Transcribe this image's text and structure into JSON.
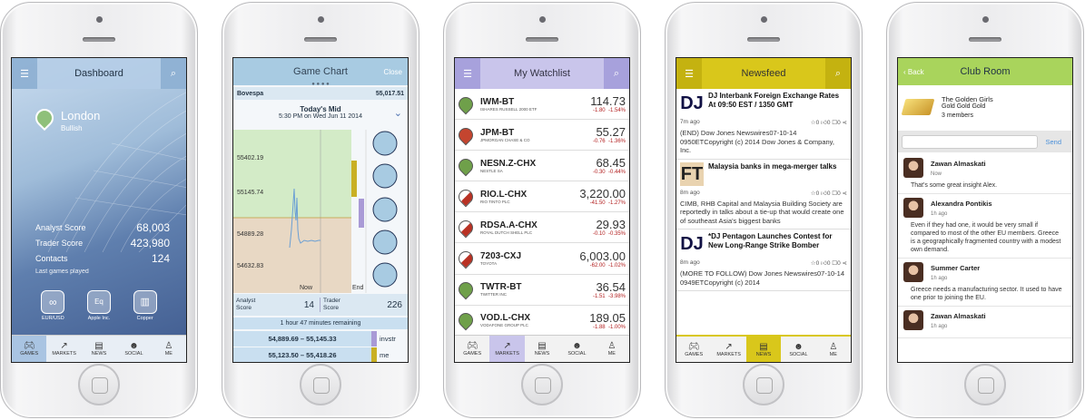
{
  "screen1": {
    "title": "Dashboard",
    "city": "London",
    "mood": "Bullish",
    "stats": [
      {
        "label": "Analyst Score",
        "value": "68,003"
      },
      {
        "label": "Trader Score",
        "value": "423,980"
      },
      {
        "label": "Contacts",
        "value": "124"
      }
    ],
    "last_label": "Last games played",
    "games": [
      {
        "label": "EUR/USD",
        "icon": "coins-icon"
      },
      {
        "label": "Apple Inc.",
        "icon": "eq-icon"
      },
      {
        "label": "Copper",
        "icon": "commodity-icon"
      }
    ]
  },
  "tabs": [
    "GAMES",
    "MARKETS",
    "NEWS",
    "SOCIAL",
    "ME"
  ],
  "screen2": {
    "title": "Game Chart",
    "close": "Close",
    "index_name": "Bovespa",
    "index_value": "55,017.51",
    "mid_title": "Today's Mid",
    "mid_time": "5:30 PM on Wed Jun 11 2014",
    "y_ticks": [
      "55402.19",
      "55145.74",
      "54889.28",
      "54632.83"
    ],
    "x_now": "Now",
    "x_end": "End",
    "analyst_label": "Analyst Score",
    "analyst_value": "14",
    "trader_label": "Trader Score",
    "trader_value": "226",
    "remaining": "1 hour 47 minutes remaining",
    "ranges": [
      {
        "range": "54,889.69 – 55,145.33",
        "tag": "invstr"
      },
      {
        "range": "55,123.50 – 55,418.26",
        "tag": "me"
      }
    ]
  },
  "screen3": {
    "title": "My Watchlist",
    "rows": [
      {
        "sym": "IWM-BT",
        "name": "ISHARES RUSSELL 2000 ETF",
        "price": "114.73",
        "chg": "-1.80",
        "pct": "-1.54%",
        "color": "green"
      },
      {
        "sym": "JPM-BT",
        "name": "JPMORGAN CHASE & CO",
        "price": "55.27",
        "chg": "-0.76",
        "pct": "-1.36%",
        "color": "red"
      },
      {
        "sym": "NESN.Z-CHX",
        "name": "NESTLE SA",
        "price": "68.45",
        "chg": "-0.30",
        "pct": "-0.44%",
        "color": "green"
      },
      {
        "sym": "RIO.L-CHX",
        "name": "RIO TINTO PLC",
        "price": "3,220.00",
        "chg": "-41.50",
        "pct": "-1.27%",
        "color": "half"
      },
      {
        "sym": "RDSA.A-CHX",
        "name": "ROYAL DUTCH SHELL PLC",
        "price": "29.93",
        "chg": "-0.10",
        "pct": "-0.35%",
        "color": "half"
      },
      {
        "sym": "7203-CXJ",
        "name": "TOYOTA",
        "price": "6,003.00",
        "chg": "-62.00",
        "pct": "-1.02%",
        "color": "half"
      },
      {
        "sym": "TWTR-BT",
        "name": "TWITTER INC",
        "price": "36.54",
        "chg": "-1.51",
        "pct": "-3.98%",
        "color": "green"
      },
      {
        "sym": "VOD.L-CHX",
        "name": "VODAFONE GROUP PLC",
        "price": "189.05",
        "chg": "-1.88",
        "pct": "-1.00%",
        "color": "green"
      }
    ]
  },
  "screen4": {
    "title": "Newsfeed",
    "items": [
      {
        "logo": "DJ",
        "head": "DJ Interbank Foreign Exchange Rates At 09:50 EST / 1350 GMT",
        "time": "7m ago",
        "body": "(END) Dow Jones Newswires07-10-14 0950ETCopyright (c) 2014 Dow Jones & Company, Inc."
      },
      {
        "logo": "FT",
        "head": "Malaysia banks in mega-merger talks",
        "time": "8m ago",
        "body": "CIMB, RHB Capital and Malaysia Building Society are reportedly in talks about a tie-up that would create one of southeast Asia's biggest banks"
      },
      {
        "logo": "DJ",
        "head": "*DJ Pentagon Launches Contest for New Long-Range Strike Bomber",
        "time": "8m ago",
        "body": "(MORE TO FOLLOW) Dow Jones Newswires07-10-14 0949ETCopyright (c) 2014"
      }
    ],
    "counts": [
      "0",
      "0",
      "0"
    ]
  },
  "screen5": {
    "back": "Back",
    "title": "Club Room",
    "club_name": "The Golden Girls",
    "club_sub": "Gold Gold Gold",
    "members": "3 members",
    "send": "Send",
    "posts": [
      {
        "name": "Zawan Almaskati",
        "time": "Now",
        "text": "That's some great insight Alex."
      },
      {
        "name": "Alexandra Pontikis",
        "time": "1h ago",
        "text": "Even if they had one, it would be very small if compared to most of the other EU members. Greece is a geographically fragmented country with a modest own demand."
      },
      {
        "name": "Summer Carter",
        "time": "1h ago",
        "text": "Greece needs a manufacturing sector. It used to have one prior to joining the EU."
      },
      {
        "name": "Zawan Almaskati",
        "time": "1h ago",
        "text": ""
      }
    ]
  }
}
